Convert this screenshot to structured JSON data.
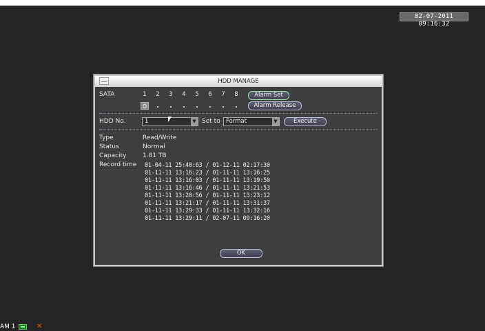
{
  "screen": {
    "datetime": "02-07-2011 09:16:32",
    "status_channel": "AM 1",
    "status_alarm_glyph": "✕"
  },
  "dialog": {
    "title": "HDD MANAGE",
    "sata_label": "SATA",
    "sata_slots": [
      "1",
      "2",
      "3",
      "4",
      "5",
      "6",
      "7",
      "8"
    ],
    "sata_selected_marker": "O",
    "alarm_set_label": "Alarm Set",
    "alarm_release_label": "Alarm Release",
    "hdd_no_label": "HDD No.",
    "hdd_no_value": "1",
    "set_to_label": "Set to",
    "set_to_value": "Format",
    "execute_label": "Execute",
    "type_label": "Type",
    "type_value": "Read/Write",
    "status_label": "Status",
    "status_value": "Normal",
    "capacity_label": "Capacity",
    "capacity_value": "1.81 TB",
    "record_time_label": "Record time",
    "record_times": [
      "01-04-11 25:40:63 / 01-12-11 02:17:30",
      "01-11-11 13:16:23 / 01-11-11 13:16:25",
      "01-11-11 13:16:03 / 01-11-11 13:19:50",
      "01-11-11 13:16:46 / 01-11-11 13:21:53",
      "01-11-11 13:20:56 / 01-11-11 13:23:12",
      "01-11-11 13:21:17 / 01-11-11 13:31:37",
      "01-11-11 13:29:33 / 01-11-11 13:32:16",
      "01-11-11 13:29:11 / 02-07-11 09:16:20"
    ],
    "ok_label": "OK"
  },
  "colors": {
    "background": "#242424",
    "dialog_bg": "#3e3e40",
    "titlebar": "#ffffff",
    "button_border": "#c0c0d8"
  },
  "icons": {
    "record_indicator": "record-icon",
    "alarm_indicator": "alarm-icon",
    "cursor": "mouse-cursor-icon"
  }
}
